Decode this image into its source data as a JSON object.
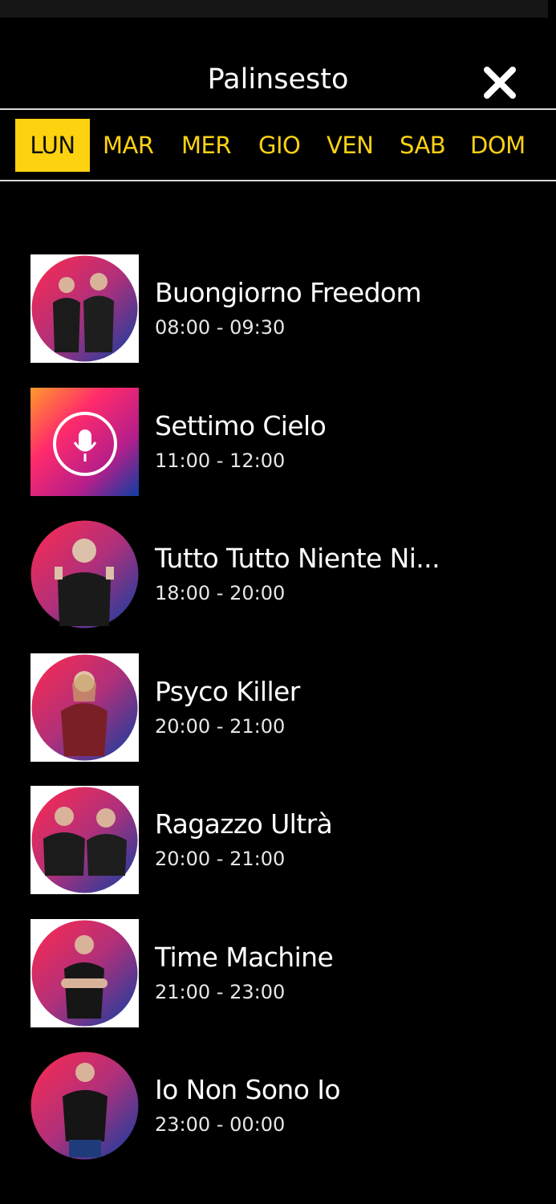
{
  "header": {
    "title": "Palinsesto",
    "close_icon": "close-icon"
  },
  "days": [
    "LUN",
    "MAR",
    "MER",
    "GIO",
    "VEN",
    "SAB",
    "DOM"
  ],
  "active_day": "LUN",
  "colors": {
    "accent": "#fdd20f",
    "background": "#000000",
    "gradient_start": "#ff2a4f",
    "gradient_end": "#0c3fa3"
  },
  "shows": [
    {
      "name": "Buongiorno Freedom",
      "time": "08:00 - 09:30",
      "image": "hosts-photo"
    },
    {
      "name": "Settimo Cielo",
      "time": "11:00 - 12:00",
      "image": "freedom-logo"
    },
    {
      "name": "Tutto Tutto Niente Ni...",
      "time": "18:00 - 20:00",
      "image": "host-photo"
    },
    {
      "name": "Psyco Killer",
      "time": "20:00 - 21:00",
      "image": "host-photo"
    },
    {
      "name": "Ragazzo Ultrà",
      "time": "20:00 - 21:00",
      "image": "hosts-photo"
    },
    {
      "name": "Time Machine",
      "time": "21:00 - 23:00",
      "image": "host-photo"
    },
    {
      "name": "Io Non Sono Io",
      "time": "23:00 - 00:00",
      "image": "host-photo"
    }
  ]
}
